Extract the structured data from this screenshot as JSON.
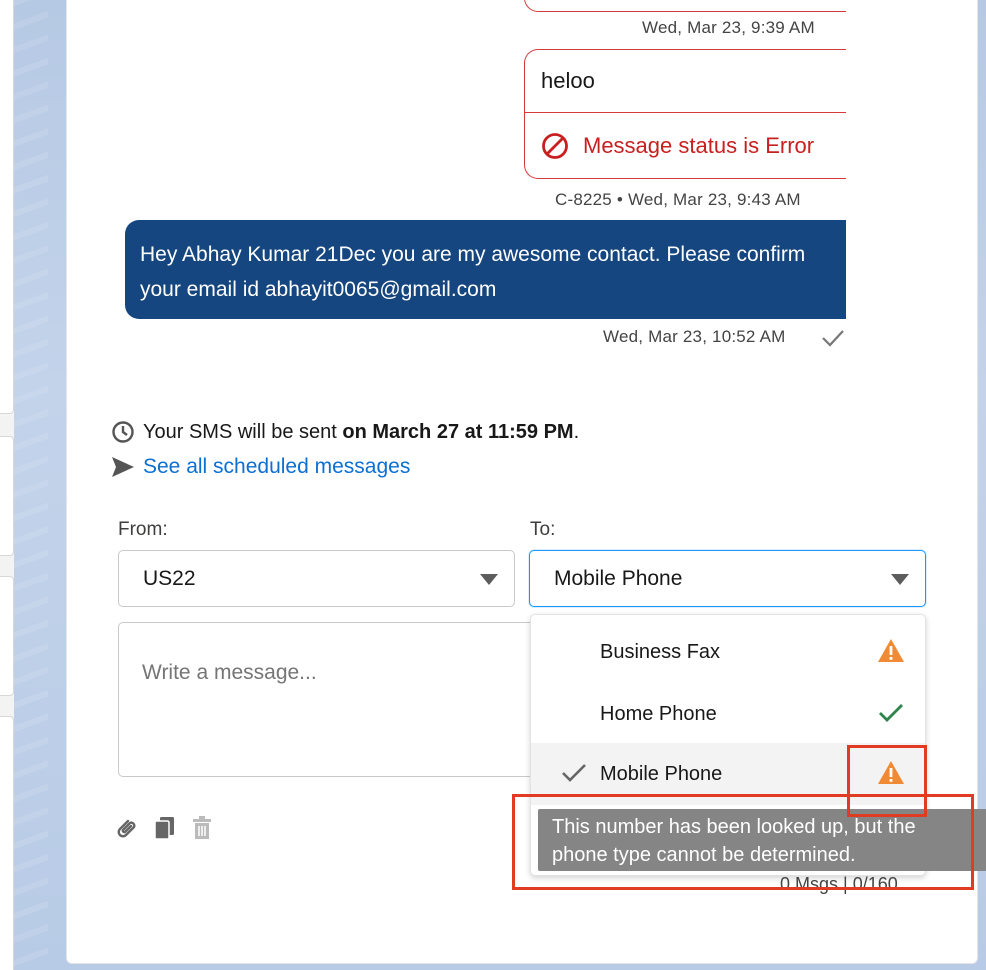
{
  "messages": {
    "top_timestamp": "Wed, Mar 23, 9:39 AM",
    "error_message": {
      "text": "heloo",
      "status": "Message status is Error",
      "meta": "C-8225 • Wed, Mar 23, 9:43 AM"
    },
    "sent_message": {
      "text": "Hey Abhay Kumar 21Dec you are my awesome contact. Please confirm your email id abhayit0065@gmail.com",
      "timestamp": "Wed, Mar 23, 10:52 AM"
    }
  },
  "schedule": {
    "prefix": "Your SMS will be sent",
    "when": "on March 27 at 11:59 PM",
    "suffix": ".",
    "link": "See all scheduled messages"
  },
  "from": {
    "label": "From:",
    "value": "US22"
  },
  "to": {
    "label": "To:",
    "value": "Mobile Phone",
    "options": [
      {
        "label": "Business Fax",
        "status": "warning-icon"
      },
      {
        "label": "Home Phone",
        "status": "check-icon"
      },
      {
        "label": "Mobile Phone",
        "status": "warning-icon",
        "selected": true
      }
    ]
  },
  "composer": {
    "placeholder": "Write a message..."
  },
  "counter": "0 Msgs | 0/160",
  "tooltip": {
    "line1": "This number has been looked up, but the",
    "line2": "phone type cannot be determined."
  },
  "colors": {
    "outgoing_bubble": "#15467f",
    "error": "#c82020",
    "warning": "#f08a35",
    "success": "#2e844a",
    "link": "#0b6fd4",
    "highlight": "#e23b24"
  }
}
